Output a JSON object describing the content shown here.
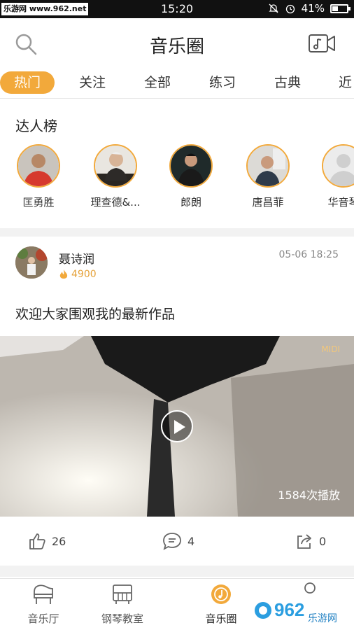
{
  "status_bar": {
    "watermark": "乐游网 www.962.net",
    "time": "15:20",
    "battery": "41%",
    "battery_level": 0.41
  },
  "header": {
    "title": "音乐圈"
  },
  "tabs": [
    "热门",
    "关注",
    "全部",
    "练习",
    "古典",
    "近"
  ],
  "ranking": {
    "title": "达人榜",
    "people": [
      "匡勇胜",
      "理查德&...",
      "郎朗",
      "唐昌菲",
      "华音琴"
    ]
  },
  "post": {
    "user": "聂诗润",
    "fire_count": "4900",
    "time": "05-06 18:25",
    "text": "欢迎大家围观我的最新作品",
    "video_badge": "MIDI",
    "plays": "1584次播放",
    "likes": "26",
    "comments": "4",
    "shares": "0"
  },
  "bottom_nav": [
    "音乐厅",
    "钢琴教室",
    "音乐圈"
  ],
  "watermark_corner": {
    "big": "962",
    "small": "乐游网"
  },
  "colors": {
    "accent": "#f2a93b",
    "text": "#222222"
  }
}
